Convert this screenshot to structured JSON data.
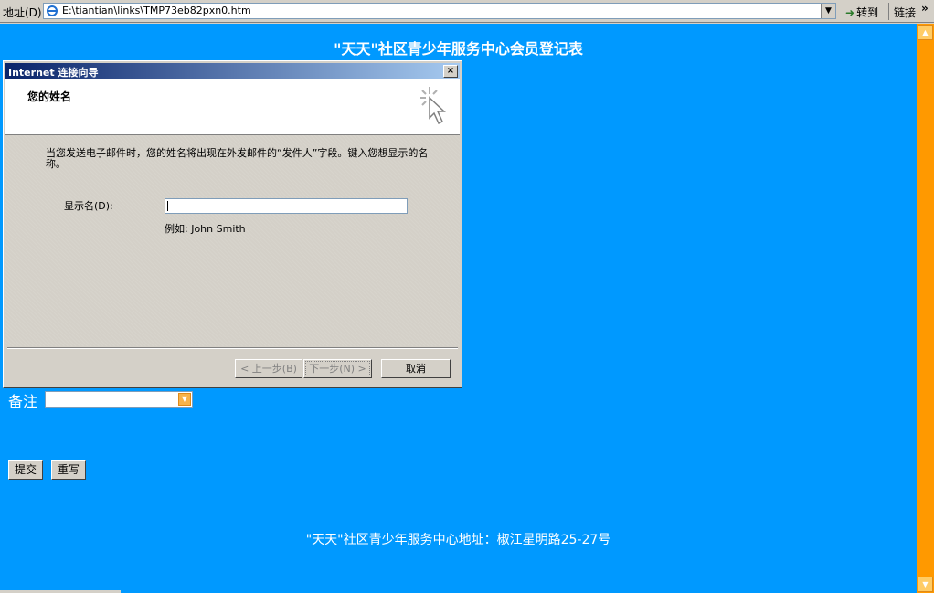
{
  "address_bar": {
    "label": "地址(D)",
    "url": "E:\\tiantian\\links\\TMP73eb82pxn0.htm",
    "go_label": "转到",
    "links_label": "链接",
    "chevron": "»"
  },
  "page": {
    "title": "\"天天\"社区青少年服务中心会员登记表",
    "remarks_label": "备注",
    "remarks_value": "",
    "submit_label": "提交",
    "reset_label": "重写",
    "footer": "\"天天\"社区青少年服务中心地址：椒江星明路25-27号"
  },
  "dialog": {
    "title": "Internet 连接向导",
    "close": "×",
    "heading": "您的姓名",
    "description": "当您发送电子邮件时，您的姓名将出现在外发邮件的“发件人”字段。键入您想显示的名称。",
    "field_label": "显示名(D):",
    "field_value": "",
    "example": "例如: John Smith",
    "back_label": "< 上一步(B)",
    "next_label": "下一步(N) >",
    "cancel_label": "取消"
  },
  "colors": {
    "page_bg": "#0099ff",
    "scrollbar": "#ff9900",
    "titlebar": "#0a246a"
  },
  "icons": [
    "ie-icon",
    "go-arrow-icon",
    "dropdown-arrow-icon",
    "wizard-cursor-icon",
    "close-icon"
  ]
}
